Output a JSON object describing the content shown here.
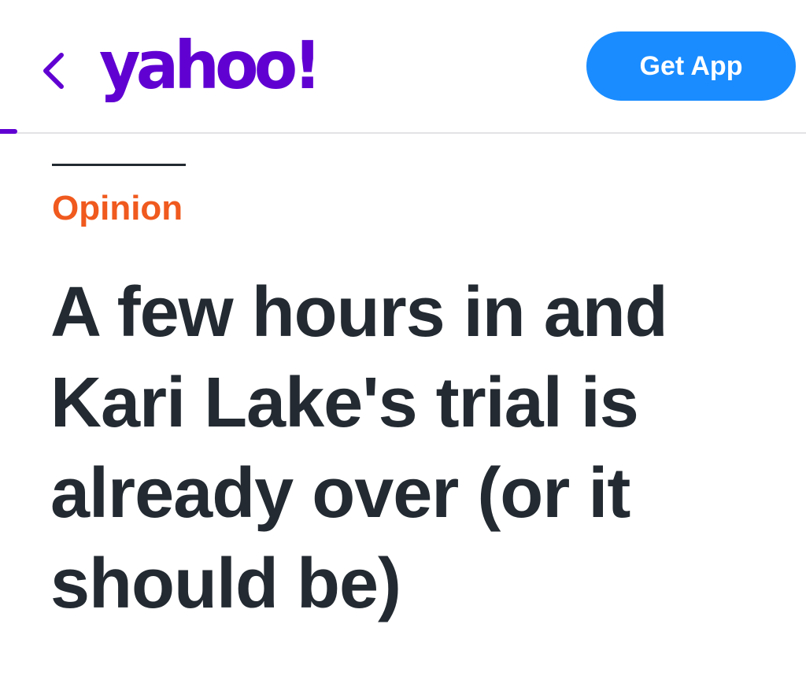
{
  "header": {
    "back_icon": "chevron-left-icon",
    "logo_text": "yahoo!",
    "get_app_label": "Get App",
    "colors": {
      "brand": "#6001d2",
      "cta": "#1a8cff"
    }
  },
  "article": {
    "kicker": "Opinion",
    "kicker_color": "#f05a1e",
    "headline": "A few hours in and Kari Lake's trial is already over (or it should be)"
  }
}
